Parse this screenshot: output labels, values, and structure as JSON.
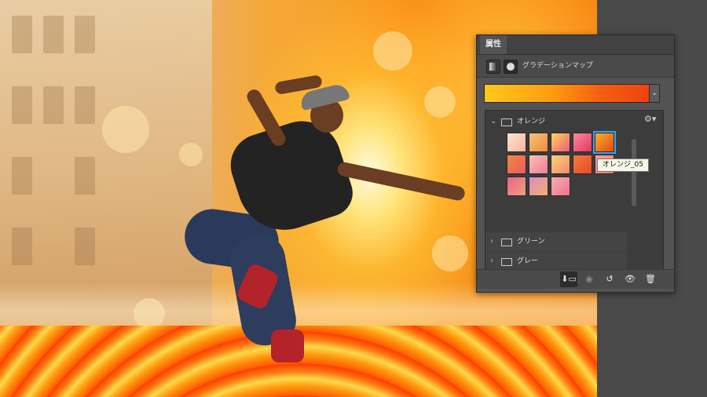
{
  "panel": {
    "tab_label": "属性",
    "adjustment_title": "グラデーションマップ",
    "dropdown_glyph": "⌄",
    "gear_glyph": "⚙▾"
  },
  "presets": {
    "folders": [
      {
        "label": "オレンジ",
        "expanded": true,
        "chevron": "⌄"
      },
      {
        "label": "グリーン",
        "expanded": false,
        "chevron": "›"
      },
      {
        "label": "グレー",
        "expanded": false,
        "chevron": "›"
      }
    ],
    "swatch_colors": [
      [
        "#fde6cf",
        "#f7b3a0"
      ],
      [
        "#f6c27a",
        "#f08a3c"
      ],
      [
        "#ffd85a",
        "#f05a7a"
      ],
      [
        "#f78aa4",
        "#e8365a"
      ],
      [
        "#f5b02a",
        "#e54a10"
      ],
      [
        "#f4883a",
        "#e85a6a"
      ],
      [
        "#f7c4b4",
        "#f07a9a"
      ],
      [
        "#f9d27a",
        "#f08a6a"
      ],
      [
        "#f57a3a",
        "#e84a2a"
      ],
      [
        "#f8a0a0",
        "#f07a5a"
      ],
      [
        "#e8648a",
        "#f0a07a"
      ],
      [
        "#d88ad0",
        "#f5b060"
      ],
      [
        "#f7b0b4",
        "#f0708a"
      ]
    ],
    "selected_index": 4,
    "tooltip": "オレンジ_05"
  },
  "footer": {
    "buttons": [
      {
        "name": "clip-to-layer-button",
        "glyph": "⬇▭",
        "active": true
      },
      {
        "name": "view-previous-state-button",
        "glyph": "◉",
        "active": false
      },
      {
        "name": "reset-button",
        "glyph": "↺",
        "active": false
      },
      {
        "name": "toggle-visibility-button",
        "glyph": "👁",
        "active": false
      },
      {
        "name": "delete-button",
        "glyph": "🗑",
        "active": false
      }
    ]
  },
  "colors": {
    "panel_bg": "#535353",
    "selection": "#2fa7ff",
    "gradient": [
      "#ffc81e",
      "#ff9c10",
      "#f56010",
      "#f24010"
    ]
  }
}
